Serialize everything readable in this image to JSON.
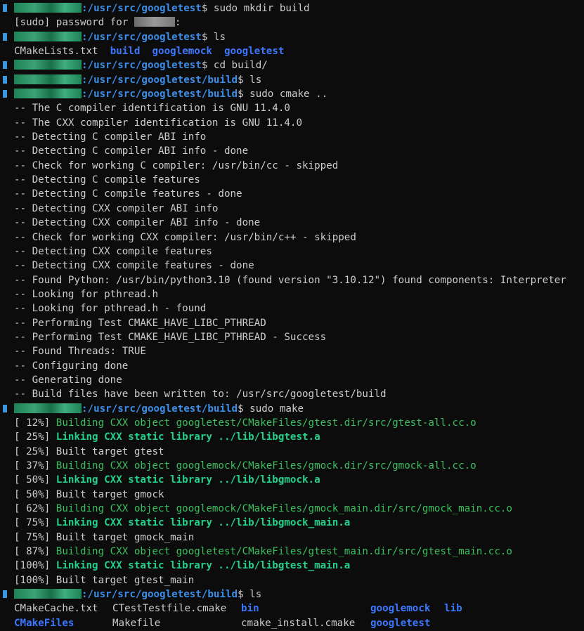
{
  "terminal": {
    "lines": [
      {
        "kind": "prompt",
        "path": ":/usr/src/googletest",
        "cmd": "$ sudo mkdir build"
      },
      {
        "kind": "sudo",
        "text": "[sudo] password for ",
        "after": ":"
      },
      {
        "kind": "prompt",
        "path": ":/usr/src/googletest",
        "cmd": "$ ls"
      },
      {
        "kind": "ls1",
        "items": [
          {
            "text": "CMakeLists.txt",
            "type": "file"
          },
          {
            "text": "build",
            "type": "dir"
          },
          {
            "text": "googlemock",
            "type": "dir"
          },
          {
            "text": "googletest",
            "type": "dir"
          }
        ]
      },
      {
        "kind": "prompt",
        "path": ":/usr/src/googletest",
        "cmd": "$ cd build/"
      },
      {
        "kind": "prompt",
        "path": ":/usr/src/googletest/build",
        "cmd": "$ ls"
      },
      {
        "kind": "prompt",
        "path": ":/usr/src/googletest/build",
        "cmd": "$ sudo cmake .."
      },
      {
        "kind": "out",
        "text": "-- The C compiler identification is GNU 11.4.0"
      },
      {
        "kind": "out",
        "text": "-- The CXX compiler identification is GNU 11.4.0"
      },
      {
        "kind": "out",
        "text": "-- Detecting C compiler ABI info"
      },
      {
        "kind": "out",
        "text": "-- Detecting C compiler ABI info - done"
      },
      {
        "kind": "out",
        "text": "-- Check for working C compiler: /usr/bin/cc - skipped"
      },
      {
        "kind": "out",
        "text": "-- Detecting C compile features"
      },
      {
        "kind": "out",
        "text": "-- Detecting C compile features - done"
      },
      {
        "kind": "out",
        "text": "-- Detecting CXX compiler ABI info"
      },
      {
        "kind": "out",
        "text": "-- Detecting CXX compiler ABI info - done"
      },
      {
        "kind": "out",
        "text": "-- Check for working CXX compiler: /usr/bin/c++ - skipped"
      },
      {
        "kind": "out",
        "text": "-- Detecting CXX compile features"
      },
      {
        "kind": "out",
        "text": "-- Detecting CXX compile features - done"
      },
      {
        "kind": "out",
        "text": "-- Found Python: /usr/bin/python3.10 (found version \"3.10.12\") found components: Interpreter"
      },
      {
        "kind": "out",
        "text": "-- Looking for pthread.h"
      },
      {
        "kind": "out",
        "text": "-- Looking for pthread.h - found"
      },
      {
        "kind": "out",
        "text": "-- Performing Test CMAKE_HAVE_LIBC_PTHREAD"
      },
      {
        "kind": "out",
        "text": "-- Performing Test CMAKE_HAVE_LIBC_PTHREAD - Success"
      },
      {
        "kind": "out",
        "text": "-- Found Threads: TRUE"
      },
      {
        "kind": "out",
        "text": "-- Configuring done"
      },
      {
        "kind": "out",
        "text": "-- Generating done"
      },
      {
        "kind": "out",
        "text": "-- Build files have been written to: /usr/src/googletest/build"
      },
      {
        "kind": "prompt",
        "path": ":/usr/src/googletest/build",
        "cmd": "$ sudo make"
      },
      {
        "kind": "make",
        "pct": "[ 12%] ",
        "style": "build",
        "text": "Building CXX object googletest/CMakeFiles/gtest.dir/src/gtest-all.cc.o"
      },
      {
        "kind": "make",
        "pct": "[ 25%] ",
        "style": "link",
        "text": "Linking CXX static library ../lib/libgtest.a"
      },
      {
        "kind": "make",
        "pct": "[ 25%] ",
        "style": "plain",
        "text": "Built target gtest"
      },
      {
        "kind": "make",
        "pct": "[ 37%] ",
        "style": "build",
        "text": "Building CXX object googlemock/CMakeFiles/gmock.dir/src/gmock-all.cc.o"
      },
      {
        "kind": "make",
        "pct": "[ 50%] ",
        "style": "link",
        "text": "Linking CXX static library ../lib/libgmock.a"
      },
      {
        "kind": "make",
        "pct": "[ 50%] ",
        "style": "plain",
        "text": "Built target gmock"
      },
      {
        "kind": "make",
        "pct": "[ 62%] ",
        "style": "build",
        "text": "Building CXX object googlemock/CMakeFiles/gmock_main.dir/src/gmock_main.cc.o"
      },
      {
        "kind": "make",
        "pct": "[ 75%] ",
        "style": "link",
        "text": "Linking CXX static library ../lib/libgmock_main.a"
      },
      {
        "kind": "make",
        "pct": "[ 75%] ",
        "style": "plain",
        "text": "Built target gmock_main"
      },
      {
        "kind": "make",
        "pct": "[ 87%] ",
        "style": "build",
        "text": "Building CXX object googletest/CMakeFiles/gtest_main.dir/src/gtest_main.cc.o"
      },
      {
        "kind": "make",
        "pct": "[100%] ",
        "style": "link",
        "text": "Linking CXX static library ../lib/libgtest_main.a"
      },
      {
        "kind": "make",
        "pct": "[100%] ",
        "style": "plain",
        "text": "Built target gtest_main"
      },
      {
        "kind": "prompt",
        "path": ":/usr/src/googletest/build",
        "cmd": "$ ls"
      },
      {
        "kind": "lsgrid",
        "items": [
          {
            "text": "CMakeCache.txt",
            "type": "file"
          },
          {
            "text": "CTestTestfile.cmake",
            "type": "file"
          },
          {
            "text": "bin",
            "type": "dir"
          },
          {
            "text": "googlemock",
            "type": "dir"
          },
          {
            "text": "lib",
            "type": "dir"
          }
        ]
      },
      {
        "kind": "lsgrid",
        "items": [
          {
            "text": "CMakeFiles",
            "type": "dir"
          },
          {
            "text": "Makefile",
            "type": "file"
          },
          {
            "text": "cmake_install.cmake",
            "type": "file"
          },
          {
            "text": "googletest",
            "type": "dir"
          }
        ]
      }
    ]
  },
  "colors": {
    "background": "#0c0c0c",
    "text": "#cccccc",
    "path": "#3b8eea",
    "dir": "#3b78ff",
    "build_green": "#3bbf5e",
    "link_green": "#23d18b"
  }
}
